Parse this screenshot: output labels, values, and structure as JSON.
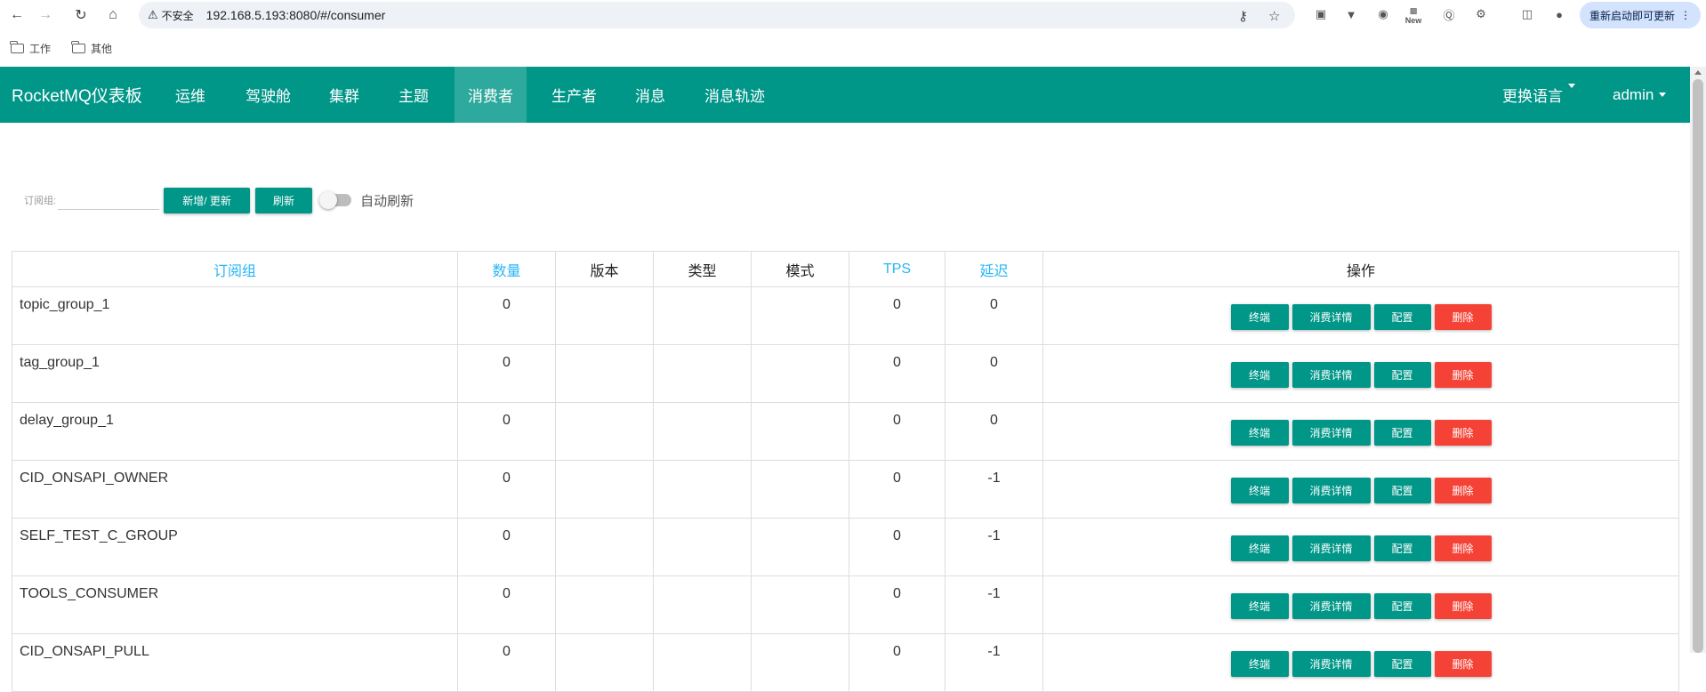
{
  "browser": {
    "url_security_label": "不安全",
    "url": "192.168.5.193:8080/#/consumer",
    "update_label": "重新启动即可更新",
    "new_badge": "New",
    "bookmarks": [
      "工作",
      "其他"
    ]
  },
  "app": {
    "brand": "RocketMQ仪表板",
    "nav": [
      "运维",
      "驾驶舱",
      "集群",
      "主题",
      "消费者",
      "生产者",
      "消息",
      "消息轨迹"
    ],
    "active_nav": "消费者",
    "language_menu": "更换语言",
    "user_menu": "admin"
  },
  "filter": {
    "label": "订阅组:",
    "value": "",
    "add_update_button": "新增/ 更新",
    "refresh_button": "刷新",
    "auto_refresh_label": "自动刷新",
    "auto_refresh_on": false
  },
  "table": {
    "columns": {
      "group": "订阅组",
      "count": "数量",
      "version": "版本",
      "type": "类型",
      "mode": "模式",
      "tps": "TPS",
      "delay": "延迟",
      "actions": "操作"
    },
    "action_labels": {
      "terminal": "终端",
      "detail": "消费详情",
      "config": "配置",
      "delete": "删除"
    },
    "rows": [
      {
        "group": "topic_group_1",
        "count": "0",
        "version": "",
        "type": "",
        "mode": "",
        "tps": "0",
        "delay": "0"
      },
      {
        "group": "tag_group_1",
        "count": "0",
        "version": "",
        "type": "",
        "mode": "",
        "tps": "0",
        "delay": "0"
      },
      {
        "group": "delay_group_1",
        "count": "0",
        "version": "",
        "type": "",
        "mode": "",
        "tps": "0",
        "delay": "0"
      },
      {
        "group": "CID_ONSAPI_OWNER",
        "count": "0",
        "version": "",
        "type": "",
        "mode": "",
        "tps": "0",
        "delay": "-1"
      },
      {
        "group": "SELF_TEST_C_GROUP",
        "count": "0",
        "version": "",
        "type": "",
        "mode": "",
        "tps": "0",
        "delay": "-1"
      },
      {
        "group": "TOOLS_CONSUMER",
        "count": "0",
        "version": "",
        "type": "",
        "mode": "",
        "tps": "0",
        "delay": "-1"
      },
      {
        "group": "CID_ONSAPI_PULL",
        "count": "0",
        "version": "",
        "type": "",
        "mode": "",
        "tps": "0",
        "delay": "-1"
      }
    ]
  },
  "colors": {
    "primary": "#009688",
    "danger": "#f44336",
    "sortable_header": "#29b6f6"
  }
}
